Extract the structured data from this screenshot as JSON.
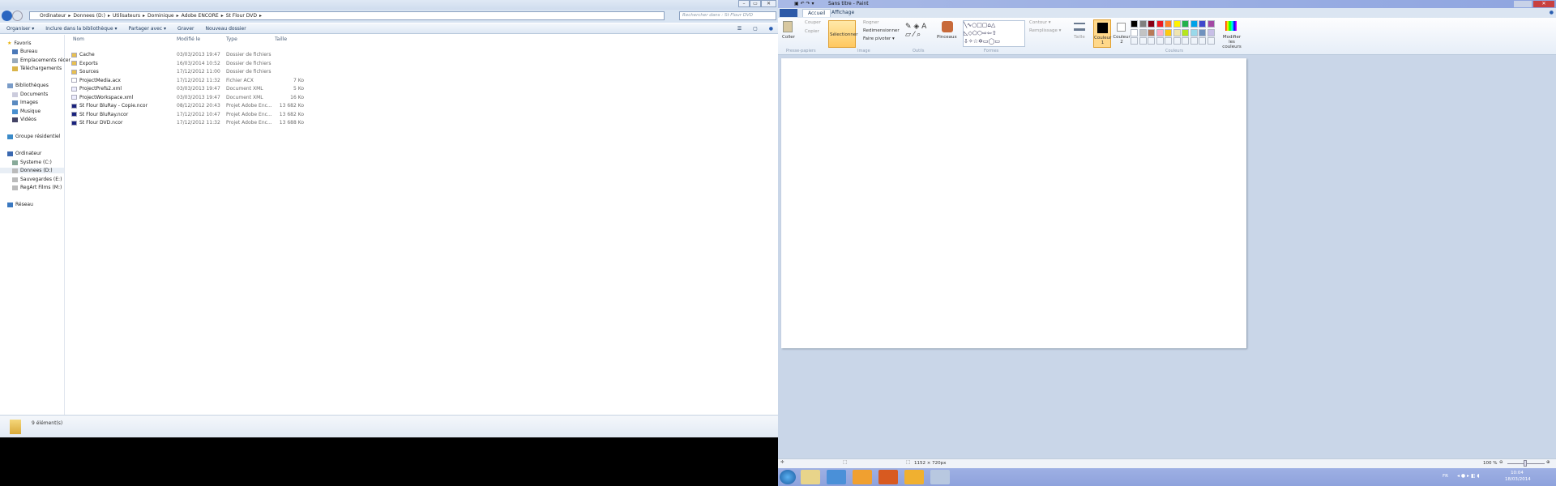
{
  "explorer": {
    "breadcrumb": [
      "Ordinateur",
      "Donnees (D:)",
      "Utilisateurs",
      "Dominique",
      "Adobe ENCORE",
      "St Flour DVD"
    ],
    "search_placeholder": "Rechercher dans : St Flour DVD",
    "toolbar": [
      "Organiser ▾",
      "Inclure dans la bibliothèque ▾",
      "Partager avec ▾",
      "Graver",
      "Nouveau dossier"
    ],
    "nav": {
      "favorites": "Favoris",
      "fav_items": [
        "Bureau",
        "Emplacements récer",
        "Téléchargements"
      ],
      "libraries": "Bibliothèques",
      "lib_items": [
        "Documents",
        "Images",
        "Musique",
        "Vidéos"
      ],
      "homegroup": "Groupe résidentiel",
      "computer": "Ordinateur",
      "drives": [
        "Systeme (C:)",
        "Donnees (D:)",
        "Sauvegardes (E:)",
        "RegArt Films (M:)"
      ],
      "network": "Réseau"
    },
    "columns": [
      "Nom",
      "Modifié le",
      "Type",
      "Taille"
    ],
    "files": [
      {
        "name": "Cache",
        "date": "03/03/2013 19:47",
        "type": "Dossier de fichiers",
        "size": "",
        "kind": "folder"
      },
      {
        "name": "Exports",
        "date": "16/03/2014 10:52",
        "type": "Dossier de fichiers",
        "size": "",
        "kind": "folder"
      },
      {
        "name": "Sources",
        "date": "17/12/2012 11:00",
        "type": "Dossier de fichiers",
        "size": "",
        "kind": "folder"
      },
      {
        "name": "ProjectMedia.acx",
        "date": "17/12/2012 11:32",
        "type": "Fichier ACX",
        "size": "7 Ko",
        "kind": "file"
      },
      {
        "name": "ProjectPrefs2.xml",
        "date": "03/03/2013 19:47",
        "type": "Document XML",
        "size": "5 Ko",
        "kind": "xml"
      },
      {
        "name": "ProjectWorkspace.xml",
        "date": "03/03/2013 19:47",
        "type": "Document XML",
        "size": "16 Ko",
        "kind": "xml"
      },
      {
        "name": "St Flour BluRay - Copie.ncor",
        "date": "08/12/2012 20:43",
        "type": "Projet Adobe Enc...",
        "size": "13 682 Ko",
        "kind": "ncor"
      },
      {
        "name": "St Flour BluRay.ncor",
        "date": "17/12/2012 10:47",
        "type": "Projet Adobe Enc...",
        "size": "13 682 Ko",
        "kind": "ncor"
      },
      {
        "name": "St Flour DVD.ncor",
        "date": "17/12/2012 11:32",
        "type": "Projet Adobe Enc...",
        "size": "13 688 Ko",
        "kind": "ncor"
      }
    ],
    "status": "9 élément(s)"
  },
  "paint": {
    "title": "Sans titre - Paint",
    "tabs": [
      "Accueil",
      "Affichage"
    ],
    "clipboard": {
      "paste": "Coller",
      "cut": "Couper",
      "copy": "Copier",
      "group": "Presse-papiers"
    },
    "image": {
      "select": "Sélectionner",
      "crop": "Rogner",
      "resize": "Redimensionner",
      "rotate": "Faire pivoter ▾",
      "group": "Image"
    },
    "tools_group": "Outils",
    "brushes": "Pinceaux",
    "shapes": {
      "outline": "Contour ▾",
      "fill": "Remplissage ▾",
      "group": "Formes"
    },
    "size": "Taille",
    "color1": "Couleur 1",
    "color2": "Couleur 2",
    "colors_group": "Couleurs",
    "edit_colors": "Modifier les couleurs",
    "palette": [
      "#000000",
      "#7f7f7f",
      "#880015",
      "#ed1c24",
      "#ff7f27",
      "#fff200",
      "#22b14c",
      "#00a2e8",
      "#3f48cc",
      "#a349a4",
      "#ffffff",
      "#c3c3c3",
      "#b97a57",
      "#ffaec9",
      "#ffc90e",
      "#efe4b0",
      "#b5e61d",
      "#99d9ea",
      "#7092be",
      "#c8bfe7"
    ],
    "status": {
      "size": "1152 × 720px",
      "zoom": "100 %"
    }
  },
  "taskbar": {
    "lang": "FR",
    "time": "10:04",
    "date": "18/03/2014"
  }
}
